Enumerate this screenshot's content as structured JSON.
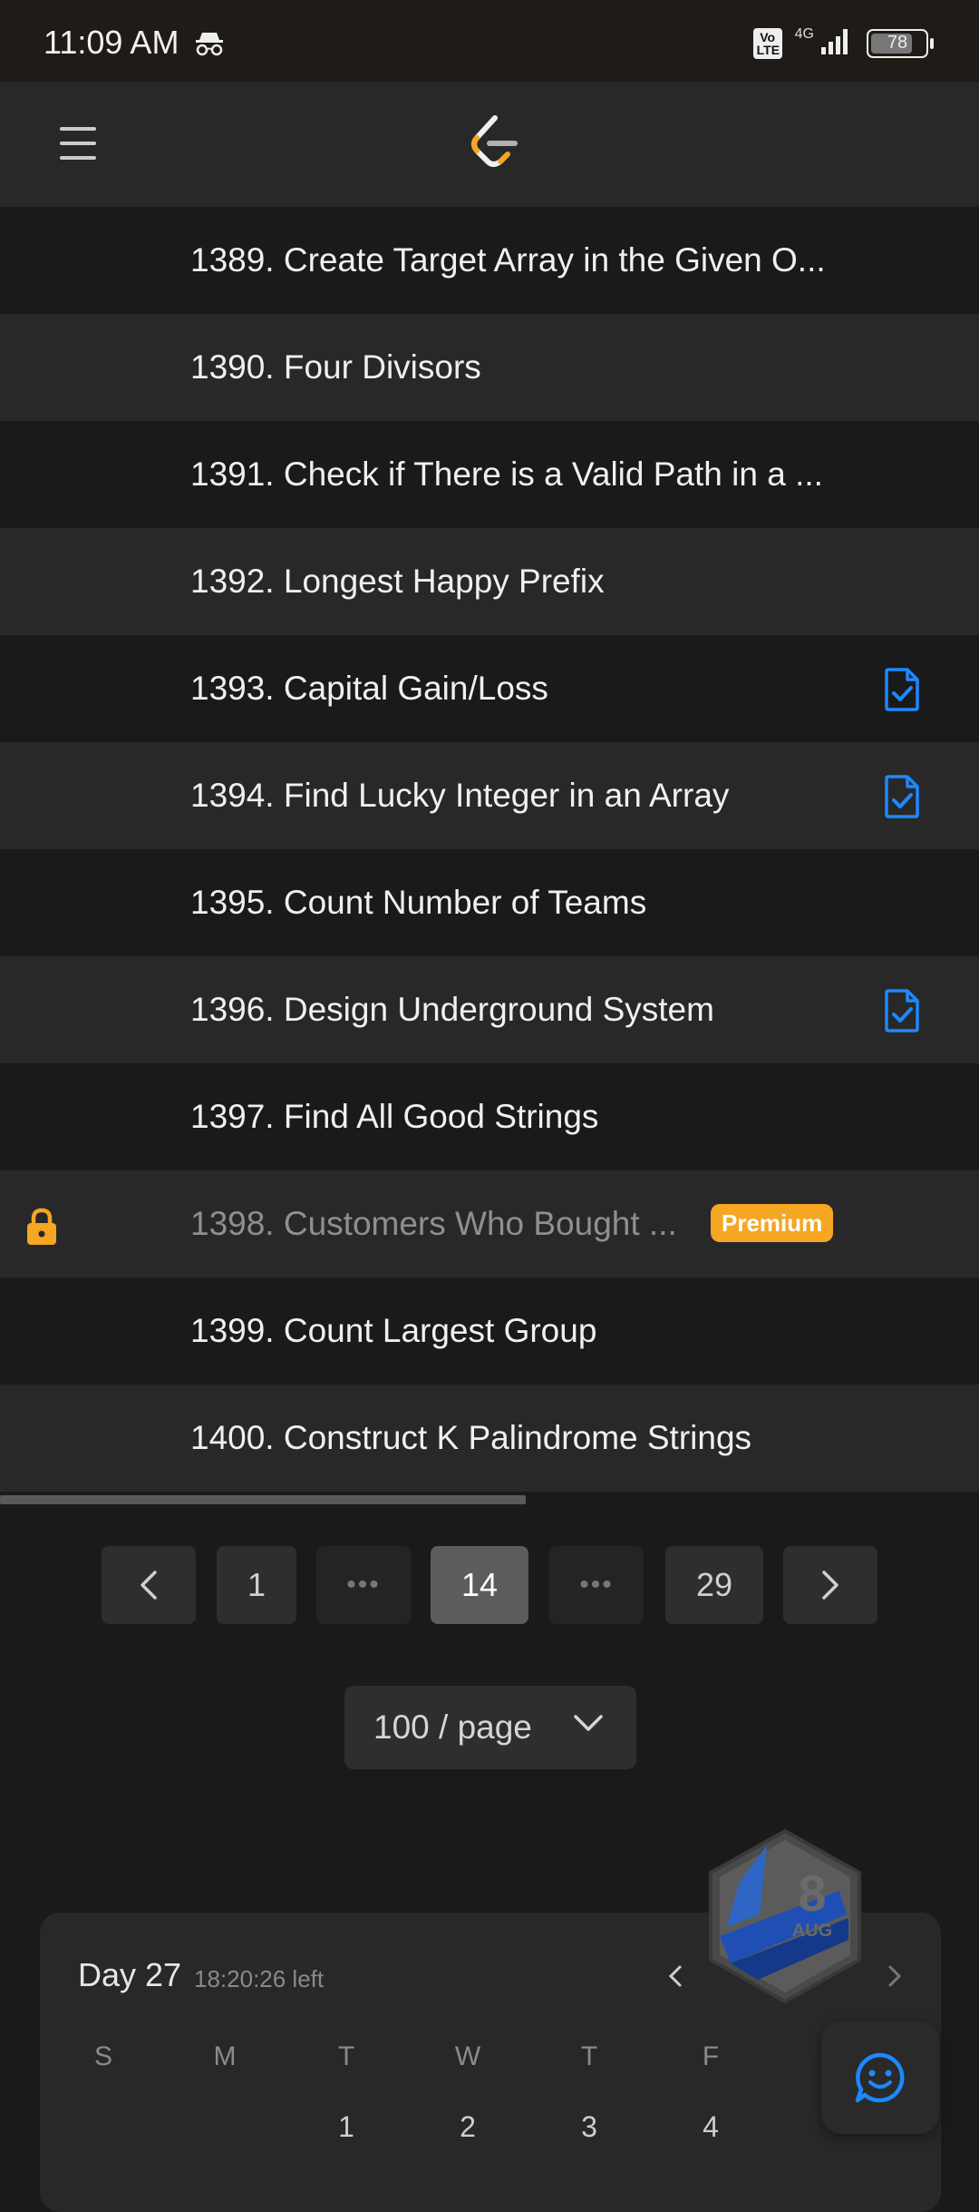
{
  "status_bar": {
    "time": "11:09 AM",
    "volte": "Vo\nLTE",
    "network": "4G",
    "battery": "78"
  },
  "problems": [
    {
      "title": "1389. Create Target Array in the Given O...",
      "solved": false,
      "locked": false
    },
    {
      "title": "1390. Four Divisors",
      "solved": false,
      "locked": false
    },
    {
      "title": "1391. Check if There is a Valid Path in a ...",
      "solved": false,
      "locked": false
    },
    {
      "title": "1392. Longest Happy Prefix",
      "solved": false,
      "locked": false
    },
    {
      "title": "1393. Capital Gain/Loss",
      "solved": true,
      "locked": false
    },
    {
      "title": "1394. Find Lucky Integer in an Array",
      "solved": true,
      "locked": false
    },
    {
      "title": "1395. Count Number of Teams",
      "solved": false,
      "locked": false
    },
    {
      "title": "1396. Design Underground System",
      "solved": true,
      "locked": false
    },
    {
      "title": "1397. Find All Good Strings",
      "solved": false,
      "locked": false
    },
    {
      "title": "1398. Customers Who Bought ...",
      "solved": false,
      "locked": true,
      "badge": "Premium"
    },
    {
      "title": "1399. Count Largest Group",
      "solved": false,
      "locked": false
    },
    {
      "title": "1400. Construct K Palindrome Strings",
      "solved": false,
      "locked": false
    }
  ],
  "pagination": {
    "first": "1",
    "ellipsis_left": "•••",
    "current": "14",
    "ellipsis_right": "•••",
    "last": "29"
  },
  "page_size": {
    "label": "100 / page"
  },
  "calendar": {
    "day_label": "Day 27",
    "time_left": "18:20:26 left",
    "weekdays": [
      "S",
      "M",
      "T",
      "W",
      "T",
      "F"
    ],
    "dates": [
      "1",
      "2",
      "3",
      "4"
    ]
  },
  "badge": {
    "day": "8",
    "month": "AUG"
  },
  "colors": {
    "accent_blue": "#1e88ff",
    "premium_orange": "#f5a623",
    "row_dark": "#1a1a1a",
    "row_light": "#282828"
  }
}
